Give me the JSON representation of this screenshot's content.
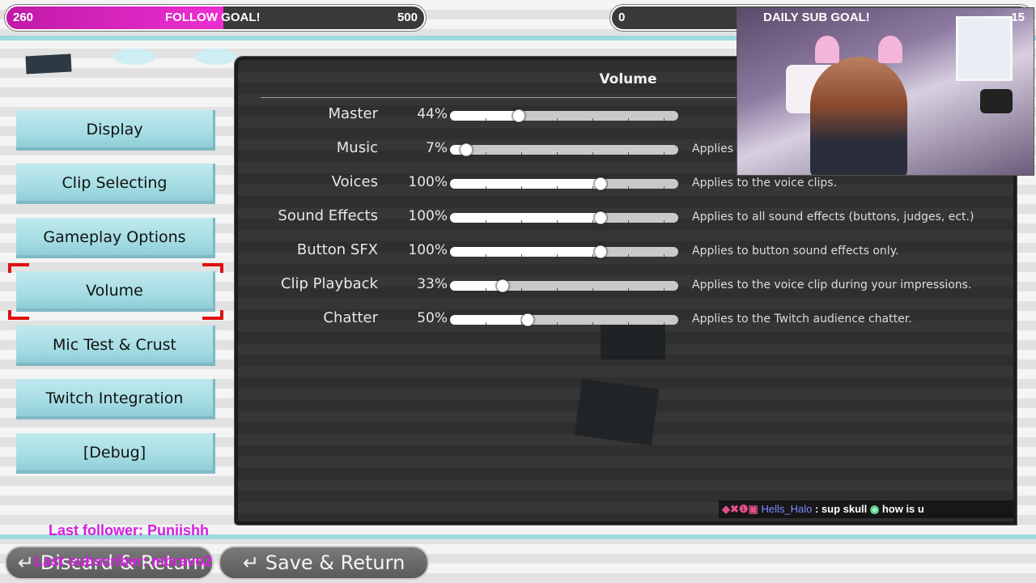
{
  "goals": {
    "follow": {
      "current": "260",
      "label": "FOLLOW GOAL!",
      "target": "500",
      "progress": 0.52
    },
    "sub": {
      "current": "0",
      "label": "DAILY SUB GOAL!",
      "target": "15",
      "progress": 0.0
    }
  },
  "menu": {
    "items": [
      {
        "label": "Display"
      },
      {
        "label": "Clip Selecting"
      },
      {
        "label": "Gameplay Options"
      },
      {
        "label": "Volume"
      },
      {
        "label": "Mic Test & Crust"
      },
      {
        "label": "Twitch Integration"
      },
      {
        "label": "[Debug]"
      }
    ],
    "selected": "Volume"
  },
  "panel": {
    "title": "Volume",
    "rows": [
      {
        "label": "Master",
        "percent": "44%",
        "value": 0.3,
        "description": ""
      },
      {
        "label": "Music",
        "percent": "7%",
        "value": 0.07,
        "description": "Applies"
      },
      {
        "label": "Voices",
        "percent": "100%",
        "value": 0.66,
        "description": "Applies to the voice clips."
      },
      {
        "label": "Sound Effects",
        "percent": "100%",
        "value": 0.66,
        "description": "Applies to all sound effects (buttons, judges, ect.)"
      },
      {
        "label": "Button SFX",
        "percent": "100%",
        "value": 0.66,
        "description": "Applies to button sound effects only."
      },
      {
        "label": "Clip Playback",
        "percent": "33%",
        "value": 0.23,
        "description": "Applies to the voice clip during your impressions."
      },
      {
        "label": "Chatter",
        "percent": "50%",
        "value": 0.34,
        "description": "Applies to the Twitch audience chatter."
      }
    ]
  },
  "chat": {
    "user": "Hells_Halo",
    "message": ": sup skull",
    "message2": "how is u"
  },
  "overlay": {
    "last_follower": "Last follower: Puniishh",
    "last_subscriber": "Last subscriber: mbravo2"
  },
  "buttons": {
    "discard": "Discard & Return",
    "save": "Save & Return",
    "return_glyph": "↵"
  },
  "colors": {
    "goal_fill": "#ec2fd1",
    "menu_button": "#a6dde4",
    "selection_bracket": "#e01010",
    "overlay_text": "#d51ee0"
  }
}
